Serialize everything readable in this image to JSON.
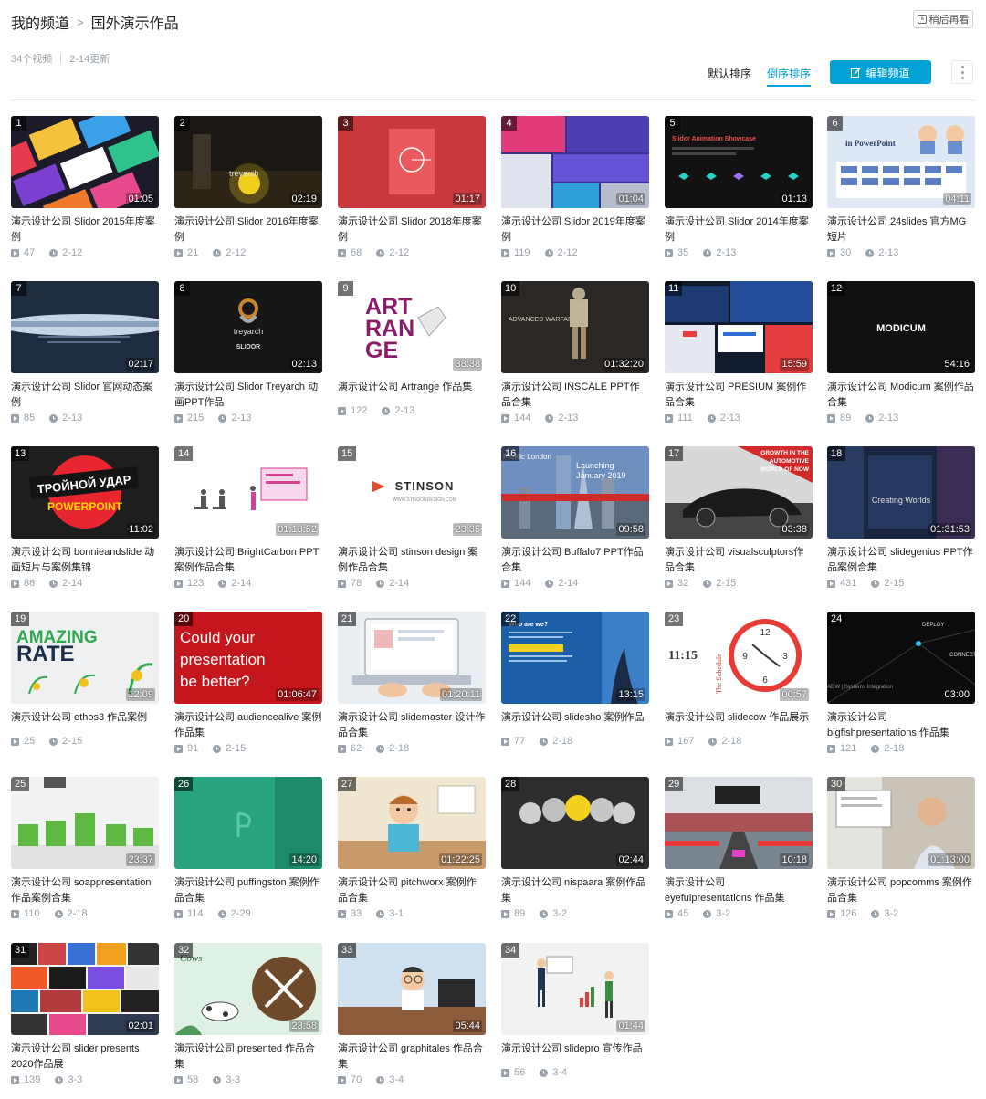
{
  "breadcrumb": {
    "root": "我的频道",
    "current": "国外演示作品"
  },
  "later_label": "稍后再看",
  "meta": {
    "count": "34个视频",
    "updated": "2-14更新"
  },
  "sort": {
    "default_label": "默认排序",
    "reverse_label": "倒序排序"
  },
  "edit_label": "编辑频道",
  "videos": [
    {
      "idx": "1",
      "title": "演示设计公司 Slidor 2015年度案例",
      "dur": "01:05",
      "plays": "47",
      "date": "2-12"
    },
    {
      "idx": "2",
      "title": "演示设计公司 Slidor 2016年度案例",
      "dur": "02:19",
      "plays": "21",
      "date": "2-12"
    },
    {
      "idx": "3",
      "title": "演示设计公司 Slidor 2018年度案例",
      "dur": "01:17",
      "plays": "68",
      "date": "2-12"
    },
    {
      "idx": "4",
      "title": "演示设计公司 Slidor 2019年度案例",
      "dur": "01:04",
      "plays": "119",
      "date": "2-12"
    },
    {
      "idx": "5",
      "title": "演示设计公司 Slidor 2014年度案例",
      "dur": "01:13",
      "plays": "35",
      "date": "2-13",
      "thumb_text": "Slidor Animation Showcase"
    },
    {
      "idx": "6",
      "title": "演示设计公司 24slides 官方MG短片",
      "dur": "04:11",
      "plays": "30",
      "date": "2-13",
      "thumb_text": "in PowerPoint"
    },
    {
      "idx": "7",
      "title": "演示设计公司 Slidor 官网动态案例",
      "dur": "02:17",
      "plays": "85",
      "date": "2-13"
    },
    {
      "idx": "8",
      "title": "演示设计公司 Slidor Treyarch 动画PPT作品",
      "dur": "02:13",
      "plays": "215",
      "date": "2-13",
      "thumb_text": "treyarch",
      "thumb_text2": "SLIDOR"
    },
    {
      "idx": "9",
      "title": "演示设计公司 Artrange 作品集",
      "dur": "38:38",
      "plays": "122",
      "date": "2-13",
      "thumb_text": "ART",
      "thumb_text2": "RAN",
      "thumb_text3": "GE"
    },
    {
      "idx": "10",
      "title": "演示设计公司 INSCALE PPT作品合集",
      "dur": "01:32:20",
      "plays": "144",
      "date": "2-13",
      "thumb_text": "ADVANCED WARFARE"
    },
    {
      "idx": "11",
      "title": "演示设计公司 PRESIUM 案例作品合集",
      "dur": "15:59",
      "plays": "111",
      "date": "2-13"
    },
    {
      "idx": "12",
      "title": "演示设计公司 Modicum 案例作品合集",
      "dur": "54:16",
      "plays": "89",
      "date": "2-13",
      "thumb_text": "MODICUM"
    },
    {
      "idx": "13",
      "title": "演示设计公司 bonnieandslide 动画短片与案例集锦",
      "dur": "11:02",
      "plays": "86",
      "date": "2-14",
      "thumb_text": "ТРОЙНОЙ УДАР",
      "thumb_text2": "POWERPOINT"
    },
    {
      "idx": "14",
      "title": "演示设计公司 BrightCarbon PPT案例作品合集",
      "dur": "01:13:52",
      "plays": "123",
      "date": "2-14"
    },
    {
      "idx": "15",
      "title": "演示设计公司 stinson design 案例作品合集",
      "dur": "23:35",
      "plays": "78",
      "date": "2-14",
      "thumb_text": "STINSON",
      "thumb_text2": "WWW.STINSONDESIGN.COM"
    },
    {
      "idx": "16",
      "title": "演示设计公司 Buffalo7 PPT作品合集",
      "dur": "09:58",
      "plays": "144",
      "date": "2-14",
      "thumb_text": "Launching",
      "thumb_text2": "January 2019",
      "thumb_text3": "Prolific London"
    },
    {
      "idx": "17",
      "title": "演示设计公司 visualsculptors作品合集",
      "dur": "03:38",
      "plays": "32",
      "date": "2-15",
      "thumb_text": "GROWTH IN THE",
      "thumb_text2": "AUTOMOTIVE",
      "thumb_text3": "WORLD OF NOW"
    },
    {
      "idx": "18",
      "title": "演示设计公司 slidegenius PPT作品案例合集",
      "dur": "01:31:53",
      "plays": "431",
      "date": "2-15",
      "thumb_text": "Creating Worlds"
    },
    {
      "idx": "19",
      "title": "演示设计公司 ethos3 作品案例",
      "dur": "12:09",
      "plays": "25",
      "date": "2-15",
      "thumb_text": "AMAZING",
      "thumb_text2": "RATE"
    },
    {
      "idx": "20",
      "title": "演示设计公司 audiencealive 案例作品集",
      "dur": "01:06:47",
      "plays": "91",
      "date": "2-15",
      "thumb_text": "Could your",
      "thumb_text2": "presentation",
      "thumb_text3": "be better?"
    },
    {
      "idx": "21",
      "title": "演示设计公司 slidemaster 设计作品合集",
      "dur": "01:20:11",
      "plays": "62",
      "date": "2-18"
    },
    {
      "idx": "22",
      "title": "演示设计公司 slidesho 案例作品",
      "dur": "13:15",
      "plays": "77",
      "date": "2-18",
      "thumb_text": "Who are we?"
    },
    {
      "idx": "23",
      "title": "演示设计公司 slidecow 作品展示",
      "dur": "00:57",
      "plays": "167",
      "date": "2-18",
      "thumb_text": "11:15",
      "thumb_text2": "The Schedule"
    },
    {
      "idx": "24",
      "title": "演示设计公司 bigfishpresentations 作品集",
      "dur": "03:00",
      "plays": "121",
      "date": "2-18",
      "thumb_text": "DEPLOY",
      "thumb_text2": "CONNECT",
      "thumb_text3": "ADW | Systems Integration"
    },
    {
      "idx": "25",
      "title": "演示设计公司 soappresentation作品案例合集",
      "dur": "23:37",
      "plays": "110",
      "date": "2-18"
    },
    {
      "idx": "26",
      "title": "演示设计公司 puffingston 案例作品合集",
      "dur": "14:20",
      "plays": "114",
      "date": "2-29"
    },
    {
      "idx": "27",
      "title": "演示设计公司 pitchworx 案例作品合集",
      "dur": "01:22:25",
      "plays": "33",
      "date": "3-1"
    },
    {
      "idx": "28",
      "title": "演示设计公司 nispaara 案例作品集",
      "dur": "02:44",
      "plays": "89",
      "date": "3-2"
    },
    {
      "idx": "29",
      "title": "演示设计公司 eyefulpresentations 作品集",
      "dur": "10:18",
      "plays": "45",
      "date": "3-2"
    },
    {
      "idx": "30",
      "title": "演示设计公司 popcomms 案例作品合集",
      "dur": "01:13:00",
      "plays": "126",
      "date": "3-2"
    },
    {
      "idx": "31",
      "title": "演示设计公司 slider presents 2020作品展",
      "dur": "02:01",
      "plays": "139",
      "date": "3-3"
    },
    {
      "idx": "32",
      "title": "演示设计公司 presented 作品合集",
      "dur": "23:58",
      "plays": "58",
      "date": "3-3",
      "thumb_text": "Cows"
    },
    {
      "idx": "33",
      "title": "演示设计公司 graphitales 作品合集",
      "dur": "05:44",
      "plays": "70",
      "date": "3-4"
    },
    {
      "idx": "34",
      "title": "演示设计公司 slidepro 宣传作品",
      "dur": "01:44",
      "plays": "56",
      "date": "3-4"
    }
  ]
}
